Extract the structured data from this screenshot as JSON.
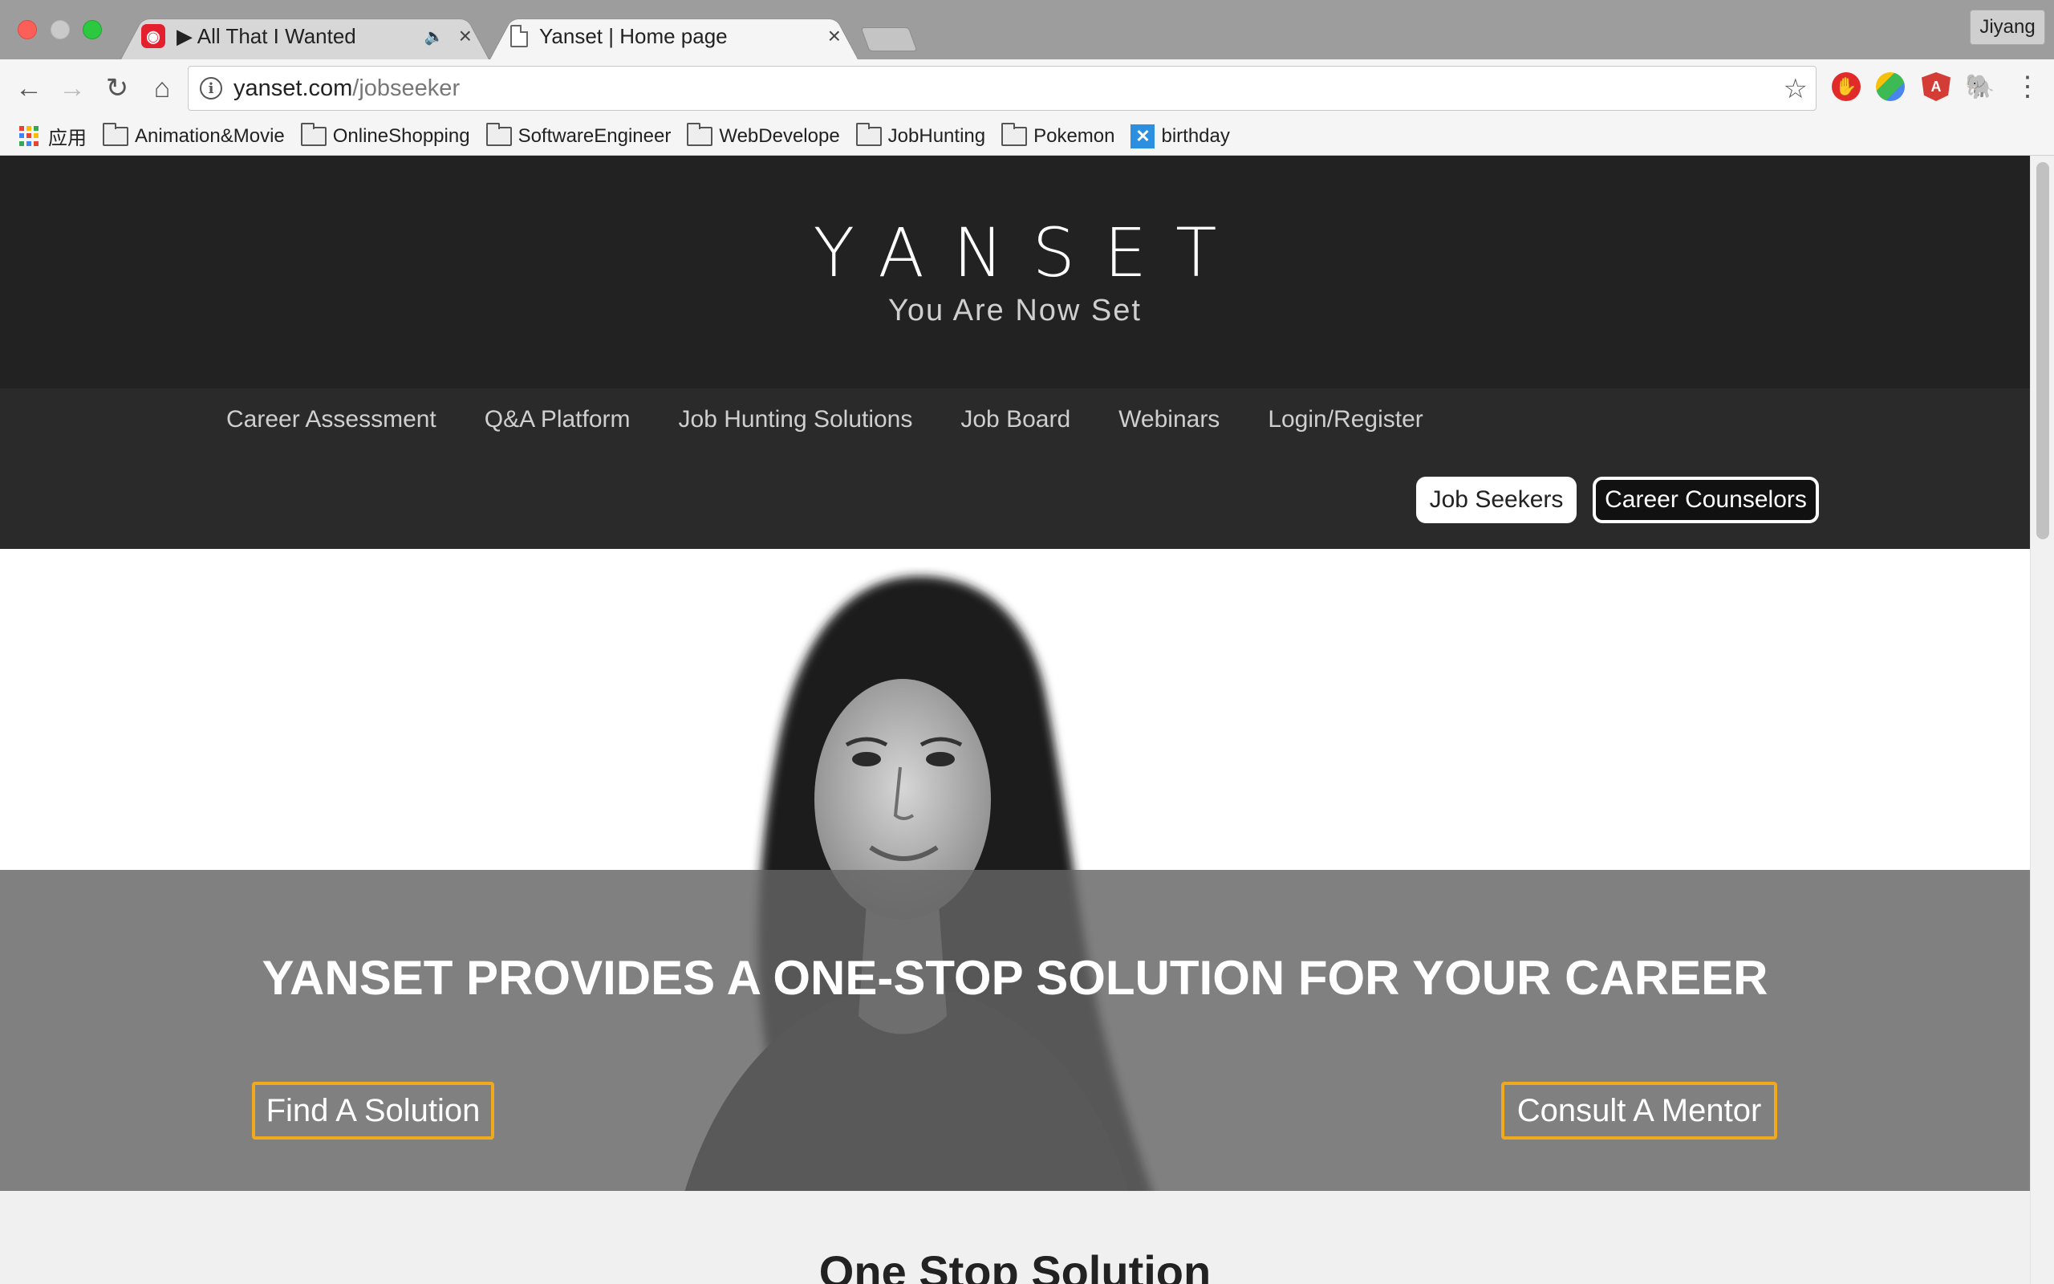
{
  "browser": {
    "tabs": [
      {
        "title": "▶ All That I Wanted",
        "favicon": "netease-music-icon",
        "audio": true
      },
      {
        "title": "Yanset | Home page",
        "favicon": "document-icon",
        "active": true
      }
    ],
    "profile_name": "Jiyang",
    "url_host": "yanset.com",
    "url_path": "/jobseeker",
    "bookmarks": [
      {
        "label": "应用",
        "icon": "apps-grid-icon"
      },
      {
        "label": "Animation&Movie",
        "icon": "folder-icon"
      },
      {
        "label": "OnlineShopping",
        "icon": "folder-icon"
      },
      {
        "label": "SoftwareEngineer",
        "icon": "folder-icon"
      },
      {
        "label": "WebDevelope",
        "icon": "folder-icon"
      },
      {
        "label": "JobHunting",
        "icon": "folder-icon"
      },
      {
        "label": "Pokemon",
        "icon": "folder-icon"
      },
      {
        "label": "birthday",
        "icon": "birthday-icon"
      }
    ]
  },
  "site": {
    "logo": "YANSET",
    "tagline": "You Are Now Set",
    "nav": [
      "Career Assessment",
      "Q&A Platform",
      "Job Hunting Solutions",
      "Job Board",
      "Webinars",
      "Login/Register"
    ],
    "role_switch": {
      "job_seekers": "Job Seekers",
      "career_counselors": "Career Counselors"
    },
    "hero": {
      "title": "YANSET PROVIDES A ONE-STOP SOLUTION FOR YOUR CAREER",
      "find_button": "Find A Solution",
      "mentor_button": "Consult A Mentor"
    },
    "section_title": "One Stop Solution"
  },
  "colors": {
    "header_bg": "#222222",
    "nav_bg": "#2a2a2a",
    "accent_orange": "#f0a81c",
    "hero_band": "#646464"
  }
}
